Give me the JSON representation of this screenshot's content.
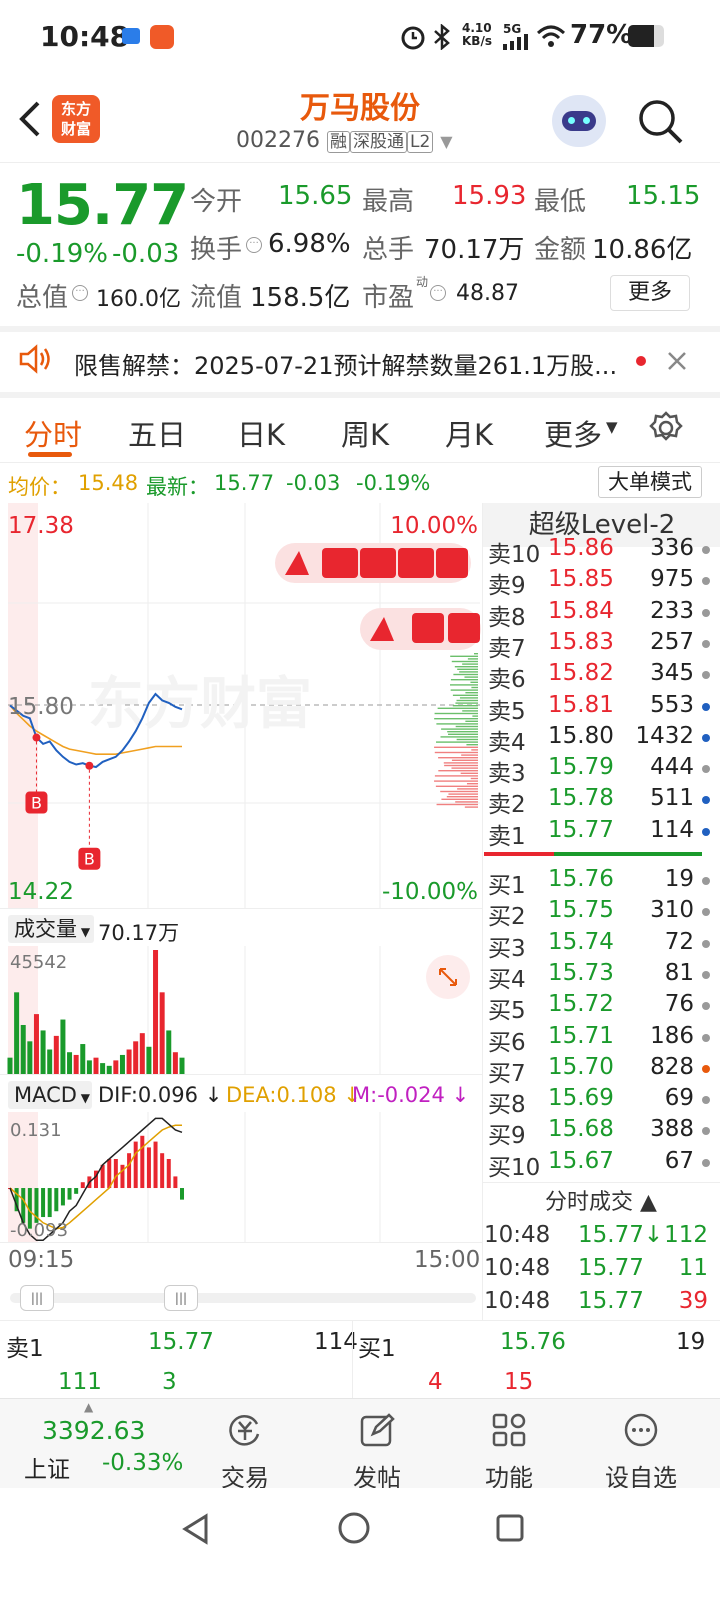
{
  "status_bar": {
    "time": "10:48",
    "net_speed_top": "4.10",
    "net_speed_unit": "KB/s",
    "signal": "5G",
    "battery": "77%"
  },
  "header": {
    "title": "万马股份",
    "code": "002276",
    "badges": [
      "融",
      "深股通",
      "L2"
    ],
    "logo_line1": "东方",
    "logo_line2": "财富"
  },
  "quote": {
    "price": "15.77",
    "change_pct": "-0.19%",
    "change": "-0.03",
    "open_label": "今开",
    "open": "15.65",
    "high_label": "最高",
    "high": "15.93",
    "low_label": "最低",
    "low": "15.15",
    "turnover_label": "换手",
    "turnover": "6.98%",
    "volume_label": "总手",
    "volume": "70.17万",
    "amount_label": "金额",
    "amount": "10.86亿",
    "mktcap_label": "总值",
    "mktcap": "160.0亿",
    "float_label": "流值",
    "float": "158.5亿",
    "pe_label": "市盈",
    "pe_sup": "动",
    "pe": "48.87",
    "more_button": "更多"
  },
  "notice": {
    "text": "限售解禁：2025-07-21预计解禁数量261.1万股..."
  },
  "tabs": [
    "分时",
    "五日",
    "日K",
    "周K",
    "月K",
    "更多"
  ],
  "chart_info": {
    "avg_label": "均价：",
    "avg": "15.48",
    "latest_label": "最新：",
    "latest": "15.77",
    "chg": "-0.03",
    "chg_pct": "-0.19%",
    "big_order_button": "大单模式"
  },
  "chart_data": {
    "type": "line",
    "y_top": "17.38",
    "y_mid": "15.80",
    "y_bottom": "14.22",
    "pct_top": "10.00%",
    "pct_bottom": "-10.00%",
    "ylim": [
      14.22,
      17.38
    ],
    "ref_price": 15.8,
    "start_time": "09:15",
    "end_time": "15:00",
    "price_series": [
      15.8,
      15.76,
      15.72,
      15.7,
      15.55,
      15.5,
      15.52,
      15.45,
      15.4,
      15.36,
      15.34,
      15.35,
      15.33,
      15.32,
      15.36,
      15.38,
      15.4,
      15.45,
      15.52,
      15.6,
      15.7,
      15.82,
      15.89,
      15.84,
      15.82,
      15.79,
      15.77
    ],
    "avg_series": [
      15.8,
      15.74,
      15.69,
      15.64,
      15.6,
      15.57,
      15.54,
      15.51,
      15.48,
      15.46,
      15.45,
      15.44,
      15.43,
      15.42,
      15.42,
      15.42,
      15.42,
      15.43,
      15.44,
      15.45,
      15.46,
      15.47,
      15.48,
      15.48,
      15.48,
      15.48,
      15.48
    ],
    "buy_markers": [
      "B",
      "B"
    ],
    "volume_label": "成交量",
    "volume_total": "70.17万",
    "volume_max": "45542",
    "volume_series": [
      6000,
      30000,
      18000,
      12000,
      22000,
      16000,
      9000,
      14000,
      20000,
      8000,
      7000,
      11000,
      5000,
      6000,
      4000,
      3000,
      5000,
      7000,
      9000,
      12000,
      15000,
      10000,
      45542,
      30000,
      16000,
      8000,
      6000
    ],
    "volume_colors": [
      "green",
      "green",
      "green",
      "green",
      "red",
      "green",
      "green",
      "red",
      "green",
      "green",
      "red",
      "green",
      "green",
      "red",
      "green",
      "green",
      "red",
      "green",
      "red",
      "red",
      "red",
      "green",
      "red",
      "red",
      "green",
      "red",
      "green"
    ],
    "macd_label": "MACD",
    "dif_label": "DIF:0.096",
    "dea_label": "DEA:0.108",
    "m_label": "M:-0.024",
    "macd_top": "0.131",
    "macd_bottom": "-0.093",
    "macd_hist": [
      0,
      -0.04,
      -0.06,
      -0.07,
      -0.06,
      -0.05,
      -0.05,
      -0.04,
      -0.03,
      -0.02,
      -0.01,
      0.01,
      0.02,
      0.03,
      0.04,
      0.05,
      0.05,
      0.04,
      0.06,
      0.08,
      0.09,
      0.07,
      0.08,
      0.06,
      0.05,
      0.02,
      -0.02
    ],
    "dif_series": [
      0,
      -0.03,
      -0.06,
      -0.08,
      -0.09,
      -0.09,
      -0.08,
      -0.07,
      -0.06,
      -0.04,
      -0.03,
      -0.01,
      0.01,
      0.02,
      0.04,
      0.05,
      0.06,
      0.07,
      0.08,
      0.09,
      0.1,
      0.11,
      0.12,
      0.12,
      0.11,
      0.1,
      0.096
    ],
    "dea_series": [
      0,
      -0.01,
      -0.02,
      -0.04,
      -0.05,
      -0.06,
      -0.065,
      -0.07,
      -0.068,
      -0.06,
      -0.05,
      -0.04,
      -0.03,
      -0.02,
      -0.01,
      0.0,
      0.02,
      0.03,
      0.04,
      0.06,
      0.07,
      0.08,
      0.09,
      0.1,
      0.105,
      0.108,
      0.108
    ]
  },
  "orderbook": {
    "title": "超级Level-2",
    "asks": [
      {
        "label": "卖10",
        "price": "15.86",
        "vol": "336"
      },
      {
        "label": "卖9",
        "price": "15.85",
        "vol": "975"
      },
      {
        "label": "卖8",
        "price": "15.84",
        "vol": "233"
      },
      {
        "label": "卖7",
        "price": "15.83",
        "vol": "257"
      },
      {
        "label": "卖6",
        "price": "15.82",
        "vol": "345"
      },
      {
        "label": "卖5",
        "price": "15.81",
        "vol": "553"
      },
      {
        "label": "卖4",
        "price": "15.80",
        "vol": "1432"
      },
      {
        "label": "卖3",
        "price": "15.79",
        "vol": "444"
      },
      {
        "label": "卖2",
        "price": "15.78",
        "vol": "511"
      },
      {
        "label": "卖1",
        "price": "15.77",
        "vol": "114"
      }
    ],
    "ask_colors": [
      "red",
      "red",
      "red",
      "red",
      "red",
      "red",
      "dark",
      "green",
      "green",
      "green"
    ],
    "ask_dots": [
      "gray",
      "gray",
      "gray",
      "gray",
      "gray",
      "blue",
      "blue",
      "gray",
      "blue",
      "blue"
    ],
    "bids": [
      {
        "label": "买1",
        "price": "15.76",
        "vol": "19"
      },
      {
        "label": "买2",
        "price": "15.75",
        "vol": "310"
      },
      {
        "label": "买3",
        "price": "15.74",
        "vol": "72"
      },
      {
        "label": "买4",
        "price": "15.73",
        "vol": "81"
      },
      {
        "label": "买5",
        "price": "15.72",
        "vol": "76"
      },
      {
        "label": "买6",
        "price": "15.71",
        "vol": "186"
      },
      {
        "label": "买7",
        "price": "15.70",
        "vol": "828"
      },
      {
        "label": "买8",
        "price": "15.69",
        "vol": "69"
      },
      {
        "label": "买9",
        "price": "15.68",
        "vol": "388"
      },
      {
        "label": "买10",
        "price": "15.67",
        "vol": "67"
      }
    ],
    "bid_dots": [
      "gray",
      "gray",
      "gray",
      "gray",
      "gray",
      "gray",
      "orange",
      "gray",
      "gray",
      "gray"
    ],
    "trades_title": "分时成交",
    "trades": [
      {
        "time": "10:48",
        "price": "15.77↓",
        "vol": "112",
        "vol_color": "green"
      },
      {
        "time": "10:48",
        "price": "15.77",
        "vol": "11",
        "vol_color": "green"
      },
      {
        "time": "10:48",
        "price": "15.77",
        "vol": "39",
        "vol_color": "red"
      }
    ]
  },
  "summary": {
    "ask1_label": "卖1",
    "ask1_price": "15.77",
    "ask1_vol": "114",
    "bid1_label": "买1",
    "bid1_price": "15.76",
    "bid1_vol": "19",
    "ask_sub1": "111",
    "ask_sub2": "3",
    "bid_sub1": "4",
    "bid_sub2": "15"
  },
  "bottom_nav": {
    "index_value": "3392.63",
    "index_name": "上证",
    "index_change": "-0.33%",
    "items": [
      "交易",
      "发帖",
      "功能",
      "设自选"
    ]
  },
  "colors": {
    "up": "#e8262f",
    "down": "#1a9a2b",
    "accent": "#e8590c",
    "avg_line": "#f0a020",
    "price_line": "#2060c0"
  }
}
